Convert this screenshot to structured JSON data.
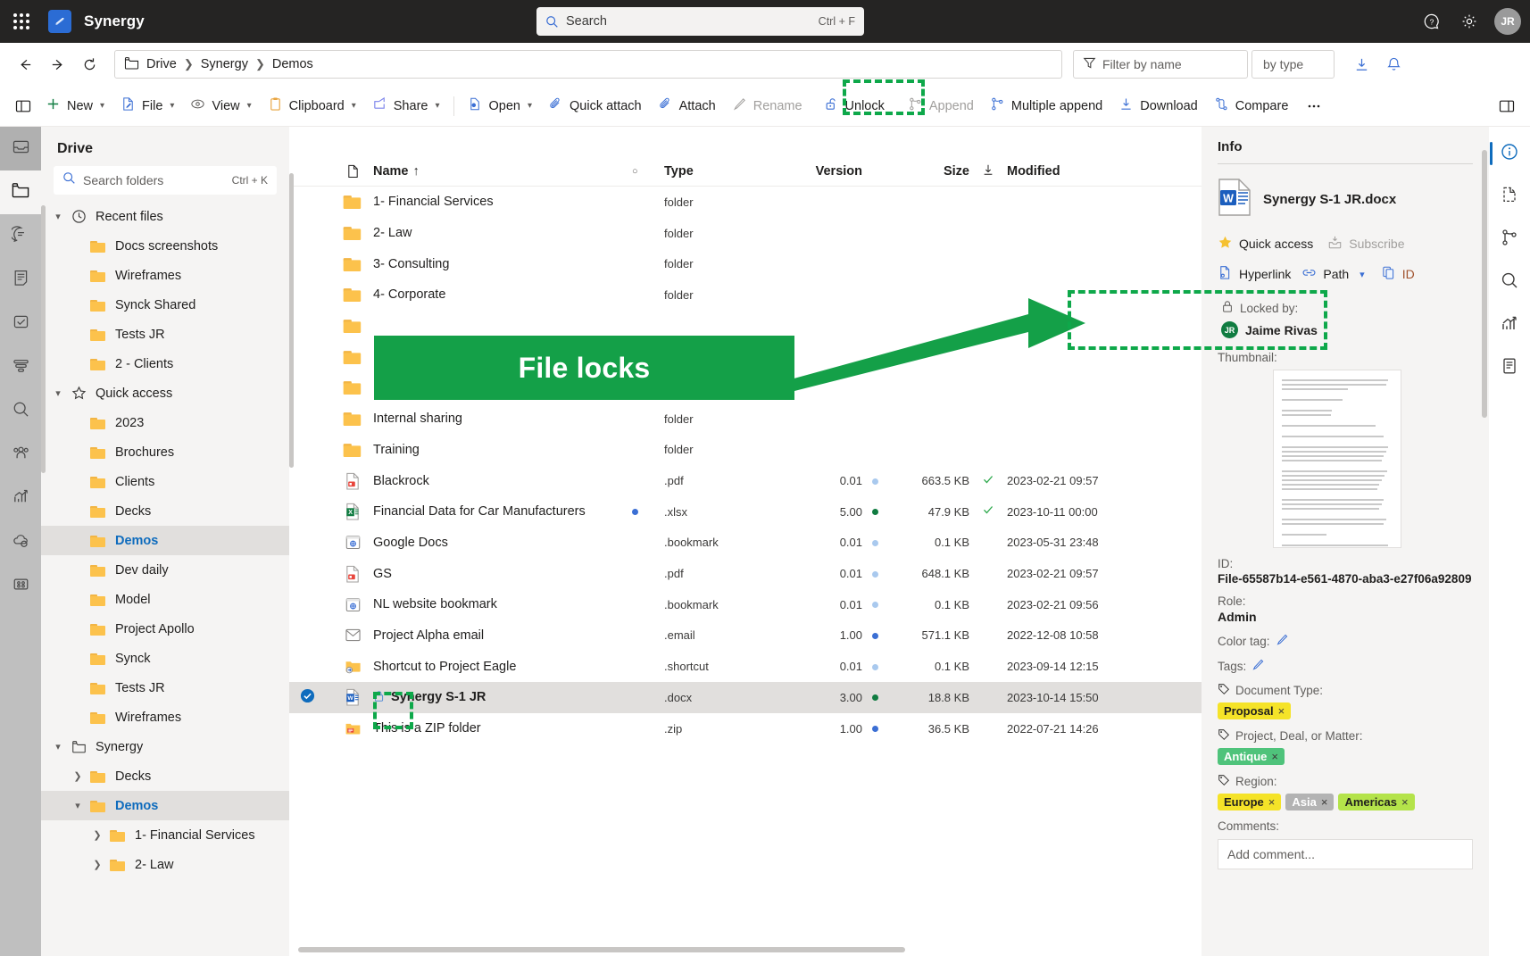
{
  "titlebar": {
    "app_name": "Synergy",
    "waffle_icon": "app-launcher-icon",
    "search": {
      "placeholder": "Search",
      "shortcut": "Ctrl + F",
      "icon": "search-icon"
    },
    "help_icon": "help-icon",
    "settings_icon": "gear-icon",
    "avatar_initials": "JR"
  },
  "navbar": {
    "back_icon": "arrow-left-icon",
    "forward_icon": "arrow-right-icon",
    "refresh_icon": "refresh-icon",
    "breadcrumb_icon": "folder-icon",
    "breadcrumb": [
      "Drive",
      "Synergy",
      "Demos"
    ],
    "filter_placeholder": "Filter by name",
    "filter_icon": "filter-icon",
    "by_type": "by type",
    "download_icon": "download-icon",
    "bell_icon": "notification-bell-icon"
  },
  "ribbon": {
    "panel_toggle_icon": "left-panel-toggle-icon",
    "items": [
      {
        "label": "New",
        "icon": "plus-icon",
        "chevron": true,
        "disabled": false
      },
      {
        "label": "File",
        "icon": "file-edit-icon",
        "chevron": true,
        "disabled": false
      },
      {
        "label": "View",
        "icon": "eye-icon",
        "chevron": true,
        "disabled": false
      },
      {
        "label": "Clipboard",
        "icon": "clipboard-icon",
        "chevron": true,
        "disabled": false
      },
      {
        "label": "Share",
        "icon": "share-icon",
        "chevron": true,
        "disabled": false
      },
      {
        "label": "Open",
        "icon": "open-file-icon",
        "chevron": true,
        "disabled": false
      },
      {
        "label": "Quick attach",
        "icon": "paperclip-icon",
        "chevron": false,
        "disabled": false
      },
      {
        "label": "Attach",
        "icon": "paperclip-icon",
        "chevron": false,
        "disabled": false
      },
      {
        "label": "Rename",
        "icon": "pencil-icon",
        "chevron": false,
        "disabled": true
      },
      {
        "label": "Unlock",
        "icon": "unlock-icon",
        "chevron": false,
        "disabled": false
      },
      {
        "label": "Append",
        "icon": "branch-icon",
        "chevron": false,
        "disabled": true
      },
      {
        "label": "Multiple append",
        "icon": "branch-icon",
        "chevron": false,
        "disabled": false
      },
      {
        "label": "Download",
        "icon": "download-icon",
        "chevron": false,
        "disabled": false
      },
      {
        "label": "Compare",
        "icon": "compare-icon",
        "chevron": false,
        "disabled": false
      }
    ],
    "overflow_icon": "more-ellipsis-icon",
    "right_panel_icon": "right-panel-toggle-icon"
  },
  "left_rail": [
    {
      "icon": "inbox-icon",
      "selected": false,
      "highlighted": true
    },
    {
      "icon": "folder-icon",
      "selected": true,
      "highlighted": false
    },
    {
      "icon": "chat-icon",
      "selected": false,
      "highlighted": false
    },
    {
      "icon": "notes-icon",
      "selected": false,
      "highlighted": false
    },
    {
      "icon": "tasks-check-icon",
      "selected": false,
      "highlighted": false
    },
    {
      "icon": "filter-stack-icon",
      "selected": false,
      "highlighted": false
    },
    {
      "icon": "search-icon",
      "selected": false,
      "highlighted": false
    },
    {
      "icon": "people-group-icon",
      "selected": false,
      "highlighted": false
    },
    {
      "icon": "analytics-chart-icon",
      "selected": false,
      "highlighted": false
    },
    {
      "icon": "cloud-sync-icon",
      "selected": false,
      "highlighted": false
    },
    {
      "icon": "apps-grid-icon",
      "selected": false,
      "highlighted": false
    }
  ],
  "sidebar": {
    "title": "Drive",
    "search_placeholder": "Search folders",
    "search_shortcut": "Ctrl + K",
    "search_icon": "search-icon",
    "tree": [
      {
        "label": "Recent files",
        "type": "group",
        "icon": "clock-icon",
        "expanded": true,
        "indent": 0
      },
      {
        "label": "Docs screenshots",
        "type": "folder",
        "indent": 1
      },
      {
        "label": "Wireframes",
        "type": "folder",
        "indent": 1
      },
      {
        "label": "Synck Shared",
        "type": "folder",
        "indent": 1
      },
      {
        "label": "Tests JR",
        "type": "folder",
        "indent": 1
      },
      {
        "label": "2 - Clients",
        "type": "folder",
        "indent": 1
      },
      {
        "label": "Quick access",
        "type": "group",
        "icon": "star-icon",
        "expanded": true,
        "indent": 0
      },
      {
        "label": "2023",
        "type": "folder",
        "indent": 1
      },
      {
        "label": "Brochures",
        "type": "folder",
        "indent": 1
      },
      {
        "label": "Clients",
        "type": "folder",
        "indent": 1
      },
      {
        "label": "Decks",
        "type": "folder",
        "indent": 1
      },
      {
        "label": "Demos",
        "type": "folder",
        "indent": 1,
        "selected": true
      },
      {
        "label": "Dev daily",
        "type": "folder",
        "indent": 1
      },
      {
        "label": "Model",
        "type": "folder",
        "indent": 1
      },
      {
        "label": "Project Apollo",
        "type": "folder",
        "indent": 1
      },
      {
        "label": "Synck",
        "type": "folder",
        "indent": 1
      },
      {
        "label": "Tests JR",
        "type": "folder",
        "indent": 1
      },
      {
        "label": "Wireframes",
        "type": "folder",
        "indent": 1
      },
      {
        "label": "Synergy",
        "type": "group",
        "icon": "folder-outline-icon",
        "expanded": true,
        "indent": 0
      },
      {
        "label": "Decks",
        "type": "folder",
        "indent": 1,
        "twisty": "collapsed"
      },
      {
        "label": "Demos",
        "type": "folder",
        "indent": 1,
        "twisty": "expanded",
        "selected": true
      },
      {
        "label": "1- Financial Services",
        "type": "folder",
        "indent": 2,
        "twisty": "collapsed"
      },
      {
        "label": "2- Law",
        "type": "folder",
        "indent": 2,
        "twisty": "collapsed"
      }
    ]
  },
  "filelist": {
    "columns": {
      "icon": "file-column-icon",
      "name": "Name",
      "name_sort": "↑",
      "dot": "○",
      "type": "Type",
      "version": "Version",
      "size": "Size",
      "size_sort": "↓",
      "modified": "Modified"
    },
    "rows": [
      {
        "name": "1- Financial Services",
        "icon": "folder-icon",
        "type": "folder",
        "version": "",
        "size": "",
        "modified": "",
        "dot": "",
        "check": false
      },
      {
        "name": "2- Law",
        "icon": "folder-icon",
        "type": "folder",
        "version": "",
        "size": "",
        "modified": "",
        "dot": "",
        "check": false
      },
      {
        "name": "3- Consulting",
        "icon": "folder-icon",
        "type": "folder",
        "version": "",
        "size": "",
        "modified": "",
        "dot": "",
        "check": false
      },
      {
        "name": "4- Corporate",
        "icon": "folder-icon",
        "type": "folder",
        "version": "",
        "size": "",
        "modified": "",
        "dot": "",
        "check": false
      },
      {
        "name": "",
        "icon": "folder-icon",
        "type": "",
        "version": "",
        "size": "",
        "modified": "",
        "dot": "",
        "check": false
      },
      {
        "name": "",
        "icon": "folder-icon",
        "type": "",
        "version": "",
        "size": "",
        "modified": "",
        "dot": "",
        "check": false
      },
      {
        "name": "",
        "icon": "folder-icon",
        "type": "",
        "version": "",
        "size": "",
        "modified": "",
        "dot": "",
        "check": false
      },
      {
        "name": "Internal sharing",
        "icon": "folder-icon",
        "type": "folder",
        "version": "",
        "size": "",
        "modified": "",
        "dot": "",
        "check": false
      },
      {
        "name": "Training",
        "icon": "folder-icon",
        "type": "folder",
        "version": "",
        "size": "",
        "modified": "",
        "dot": "",
        "check": false
      },
      {
        "name": "Blackrock",
        "icon": "pdf-icon",
        "type": ".pdf",
        "version": "0.01",
        "verdot": "#a9c9ee",
        "size": "663.5 KB",
        "modified": "2023-02-21 09:57",
        "check": true
      },
      {
        "name": "Financial Data for Car Manufacturers",
        "icon": "excel-icon",
        "type": ".xlsx",
        "version": "5.00",
        "verdot": "#107c41",
        "size": "47.9 KB",
        "modified": "2023-10-11 00:00",
        "dot": "#3b6fd4",
        "check": true
      },
      {
        "name": "Google Docs",
        "icon": "bookmark-icon",
        "type": ".bookmark",
        "version": "0.01",
        "verdot": "#a9c9ee",
        "size": "0.1 KB",
        "modified": "2023-05-31 23:48",
        "check": false
      },
      {
        "name": "GS",
        "icon": "pdf-icon",
        "type": ".pdf",
        "version": "0.01",
        "verdot": "#a9c9ee",
        "size": "648.1 KB",
        "modified": "2023-02-21 09:57",
        "check": false
      },
      {
        "name": "NL website bookmark",
        "icon": "bookmark-icon",
        "type": ".bookmark",
        "version": "0.01",
        "verdot": "#a9c9ee",
        "size": "0.1 KB",
        "modified": "2023-02-21 09:56",
        "check": false
      },
      {
        "name": "Project Alpha email",
        "icon": "email-icon",
        "type": ".email",
        "version": "1.00",
        "verdot": "#3b6fd4",
        "size": "571.1 KB",
        "modified": "2022-12-08 10:58",
        "check": false
      },
      {
        "name": "Shortcut to Project Eagle",
        "icon": "shortcut-icon",
        "type": ".shortcut",
        "version": "0.01",
        "verdot": "#a9c9ee",
        "size": "0.1 KB",
        "modified": "2023-09-14 12:15",
        "check": false
      },
      {
        "name": "Synergy S-1 JR",
        "icon": "word-icon",
        "type": ".docx",
        "version": "3.00",
        "verdot": "#107c41",
        "size": "18.8 KB",
        "modified": "2023-10-14 15:50",
        "selected": true,
        "locked": true
      },
      {
        "name": "This is a ZIP folder",
        "icon": "zip-icon",
        "type": ".zip",
        "version": "1.00",
        "verdot": "#3b6fd4",
        "size": "36.5 KB",
        "modified": "2022-07-21 14:26",
        "check": false
      }
    ]
  },
  "info_panel": {
    "title": "Info",
    "file_name": "Synergy S-1 JR.docx",
    "file_icon": "word-doc-icon",
    "quick_access": "Quick access",
    "quick_access_icon": "star-icon",
    "subscribe": "Subscribe",
    "subscribe_icon": "subscribe-icon",
    "hyperlink": "Hyperlink",
    "hyperlink_icon": "hyperlink-icon",
    "path": "Path",
    "path_icon": "link-icon",
    "path_chevron": "chevron-down-icon",
    "id_btn": "ID",
    "id_btn_icon": "copy-icon",
    "locked_by_label": "Locked by:",
    "locked_by_icon": "lock-icon",
    "locked_by_user": "Jaime Rivas",
    "locked_by_initials": "JR",
    "thumbnail_label": "Thumbnail:",
    "id_label": "ID:",
    "id_value": "File-65587b14-e561-4870-aba3-e27f06a92809",
    "role_label": "Role:",
    "role_value": "Admin",
    "color_tag_label": "Color tag:",
    "color_tag_icon": "pencil-icon",
    "tags_label": "Tags:",
    "tags_icon": "pencil-icon",
    "tag_groups": [
      {
        "label": "Document Type:",
        "icon": "tag-icon",
        "tags": [
          {
            "text": "Proposal",
            "bg": "#f5e328",
            "fg": "#201f1e"
          }
        ]
      },
      {
        "label": "Project, Deal, or Matter:",
        "icon": "tag-icon",
        "tags": [
          {
            "text": "Antique",
            "bg": "#4fc37b",
            "fg": "#ffffff"
          }
        ]
      },
      {
        "label": "Region:",
        "icon": "tag-icon",
        "tags": [
          {
            "text": "Europe",
            "bg": "#f5e328",
            "fg": "#201f1e"
          },
          {
            "text": "Asia",
            "bg": "#b3b3b3",
            "fg": "#ffffff"
          },
          {
            "text": "Americas",
            "bg": "#b4e34a",
            "fg": "#201f1e"
          }
        ]
      }
    ],
    "comments_label": "Comments:",
    "comment_placeholder": "Add comment..."
  },
  "right_rail": [
    {
      "icon": "info-circle-icon",
      "active": true
    },
    {
      "icon": "document-dashed-icon",
      "active": false
    },
    {
      "icon": "branch-icon",
      "active": false
    },
    {
      "icon": "search-icon",
      "active": false
    },
    {
      "icon": "analytics-chart-icon",
      "active": false
    },
    {
      "icon": "list-document-icon",
      "active": false
    }
  ],
  "annotation": {
    "banner_text": "File locks",
    "banner_color": "#14a048",
    "highlight_color": "#0ea84a"
  }
}
